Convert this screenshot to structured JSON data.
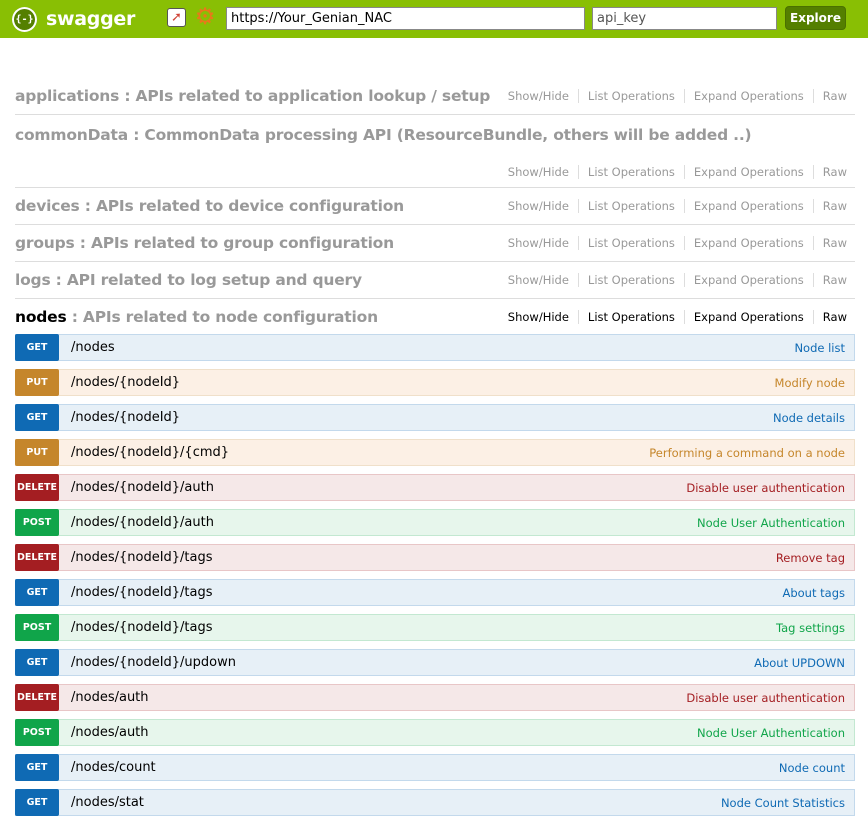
{
  "header": {
    "logo_mark": "{-}",
    "logo_text": "swagger",
    "url_value": "https://Your_Genian_NAC",
    "api_key_placeholder": "api_key",
    "explore_label": "Explore"
  },
  "op_links": {
    "show_hide": "Show/Hide",
    "list_operations": "List Operations",
    "expand_operations": "Expand Operations",
    "raw": "Raw"
  },
  "resources": [
    {
      "name": "applications",
      "desc": " : APIs related to application lookup / setup"
    },
    {
      "name": "commonData",
      "desc": " : CommonData processing API (ResourceBundle, others will be added ..)"
    },
    {
      "name": "devices",
      "desc": " : APIs related to device configuration"
    },
    {
      "name": "groups",
      "desc": " : APIs related to group configuration"
    },
    {
      "name": "logs",
      "desc": " : API related to log setup and query"
    },
    {
      "name": "nodes",
      "desc": " : APIs related to node configuration"
    }
  ],
  "operations": [
    {
      "method": "GET",
      "path": "/nodes",
      "summary": "Node list"
    },
    {
      "method": "PUT",
      "path": "/nodes/{nodeId}",
      "summary": "Modify node"
    },
    {
      "method": "GET",
      "path": "/nodes/{nodeId}",
      "summary": "Node details"
    },
    {
      "method": "PUT",
      "path": "/nodes/{nodeId}/{cmd}",
      "summary": "Performing a command on a node"
    },
    {
      "method": "DELETE",
      "path": "/nodes/{nodeId}/auth",
      "summary": "Disable user authentication"
    },
    {
      "method": "POST",
      "path": "/nodes/{nodeId}/auth",
      "summary": "Node User Authentication"
    },
    {
      "method": "DELETE",
      "path": "/nodes/{nodeId}/tags",
      "summary": "Remove tag"
    },
    {
      "method": "GET",
      "path": "/nodes/{nodeId}/tags",
      "summary": "About tags"
    },
    {
      "method": "POST",
      "path": "/nodes/{nodeId}/tags",
      "summary": "Tag settings"
    },
    {
      "method": "GET",
      "path": "/nodes/{nodeId}/updown",
      "summary": "About UPDOWN"
    },
    {
      "method": "DELETE",
      "path": "/nodes/auth",
      "summary": "Disable user authentication"
    },
    {
      "method": "POST",
      "path": "/nodes/auth",
      "summary": "Node User Authentication"
    },
    {
      "method": "GET",
      "path": "/nodes/count",
      "summary": "Node count"
    },
    {
      "method": "GET",
      "path": "/nodes/stat",
      "summary": "Node Count Statistics"
    }
  ],
  "colors": {
    "header_bg": "#89bf04",
    "get": "#0f6ab4",
    "put": "#c5862b",
    "delete": "#a41e22",
    "post": "#10a54a"
  }
}
